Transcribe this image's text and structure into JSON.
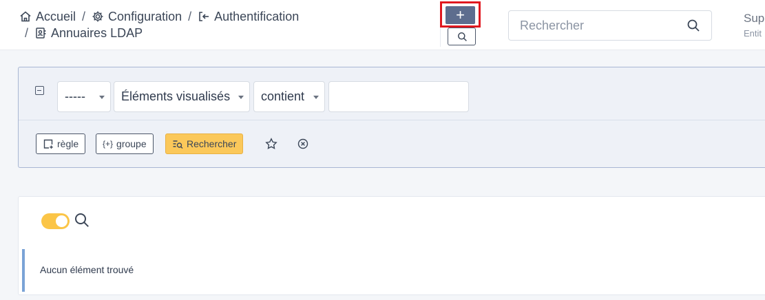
{
  "breadcrumb": {
    "items": [
      {
        "label": "Accueil",
        "icon": "home-icon"
      },
      {
        "label": "Configuration",
        "icon": "gear-icon"
      },
      {
        "label": "Authentification",
        "icon": "login-icon"
      },
      {
        "label": "Annuaires LDAP",
        "icon": "address-book-icon"
      }
    ],
    "separator": "/"
  },
  "header": {
    "add_label": "+",
    "search_placeholder": "Rechercher",
    "user_name": "Sup",
    "user_sub": "Entit"
  },
  "filter": {
    "field_select": "-----",
    "item_select": "Éléments visualisés",
    "operator_select": "contient",
    "value": "",
    "rule_label": "règle",
    "group_label": "groupe",
    "search_label": "Rechercher"
  },
  "results": {
    "empty_message": "Aucun élément trouvé"
  },
  "colors": {
    "accent_yellow": "#fbc85a",
    "add_button": "#5d6d8e",
    "highlight": "#e0171e"
  }
}
